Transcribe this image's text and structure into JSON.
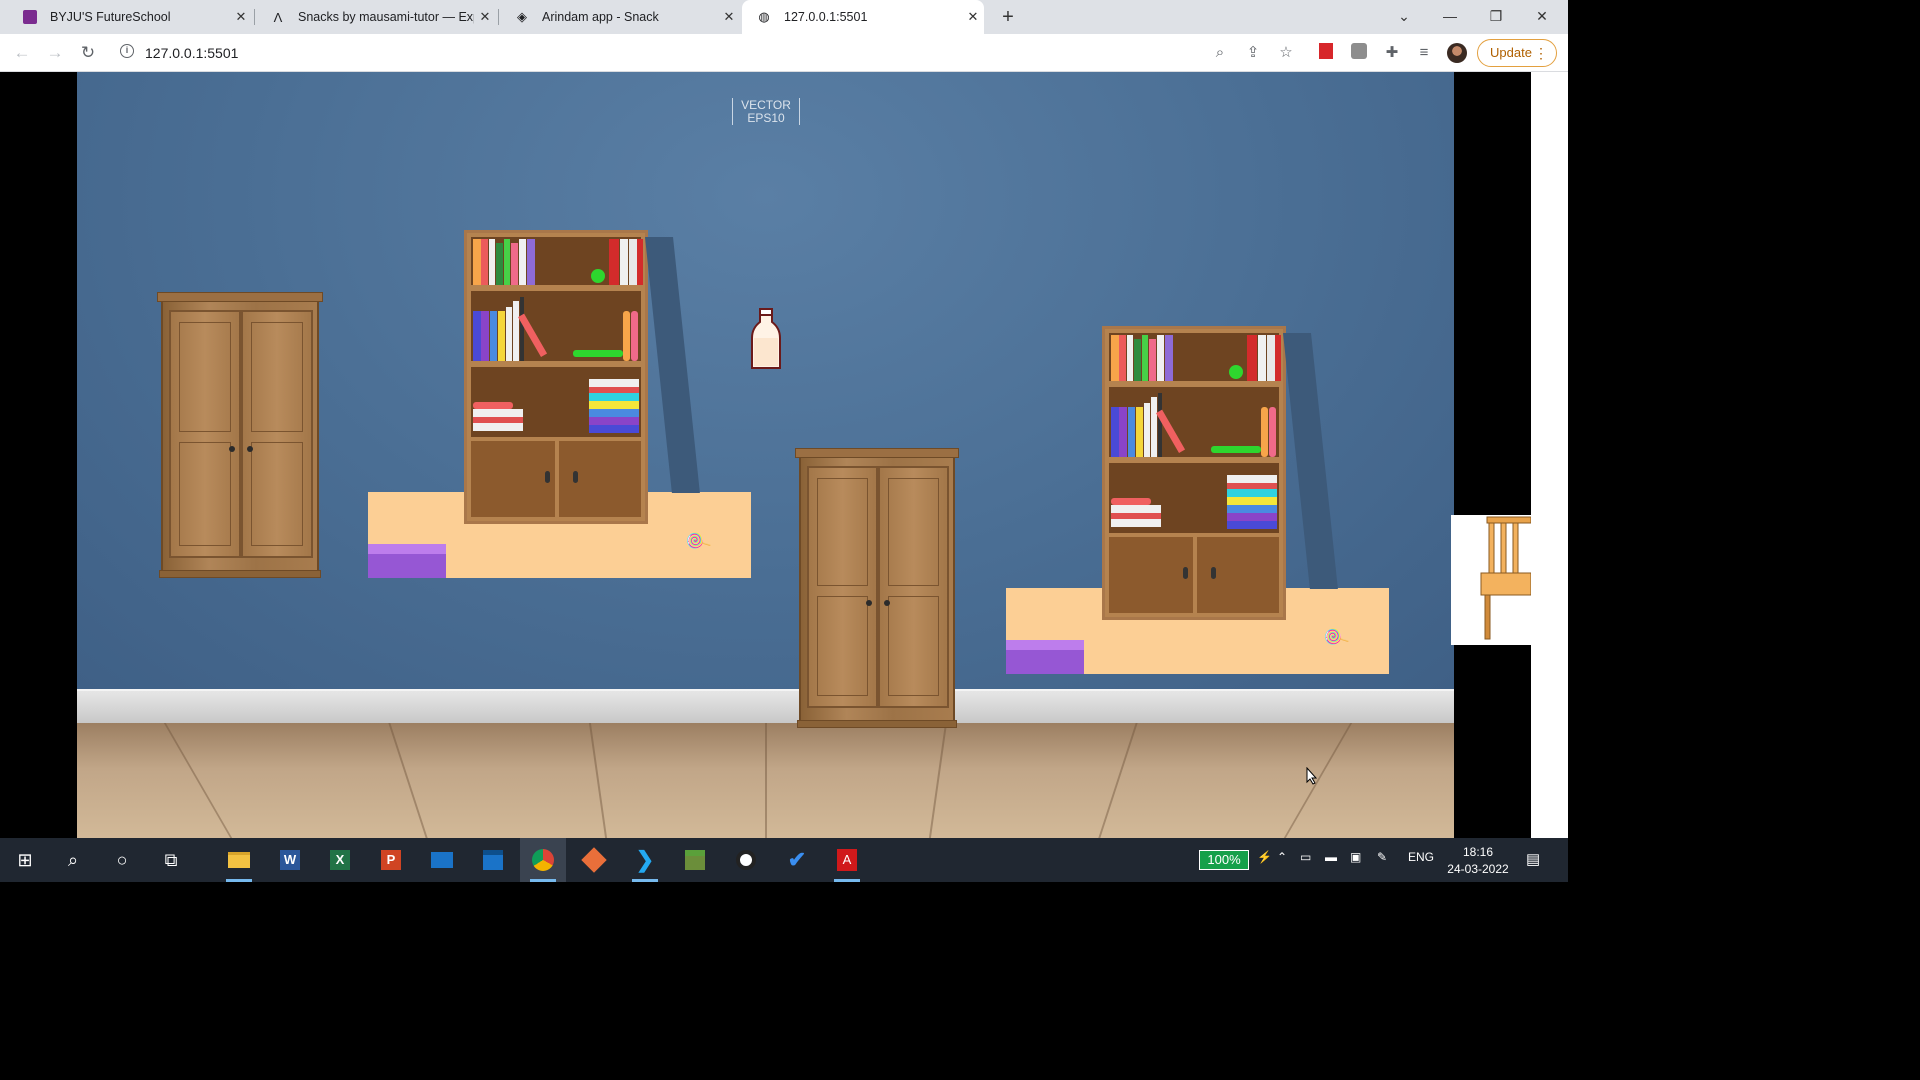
{
  "browser": {
    "tabs": [
      {
        "title": "BYJU'S FutureSchool",
        "icon": "byjus-icon"
      },
      {
        "title": "Snacks by mausami-tutor — Expo",
        "icon": "expo-icon"
      },
      {
        "title": "Arindam app - Snack",
        "icon": "snack-icon"
      },
      {
        "title": "127.0.0.1:5501",
        "icon": "globe-icon"
      }
    ],
    "active_tab": 3,
    "url": "127.0.0.1:5501",
    "update_label": "Update"
  },
  "scene": {
    "watermark_line1": "VECTOR",
    "watermark_line2": "EPS10",
    "colors": {
      "wall": "#4a6e94",
      "platform": "#fccf95",
      "cushion": "#9657d4",
      "floor": "#c1a688"
    }
  },
  "taskbar": {
    "battery": "100%",
    "lang": "ENG",
    "time": "18:16",
    "date": "24-03-2022",
    "apps": [
      "start-icon",
      "search-icon",
      "cortana-icon",
      "taskview-icon",
      "file-explorer-icon",
      "word-icon",
      "excel-icon",
      "powerpoint-icon",
      "mail-icon",
      "calendar-icon",
      "chrome-icon",
      "git-icon",
      "vscode-icon",
      "minecraft-icon",
      "bulb-icon",
      "todo-icon",
      "acrobat-icon"
    ]
  }
}
